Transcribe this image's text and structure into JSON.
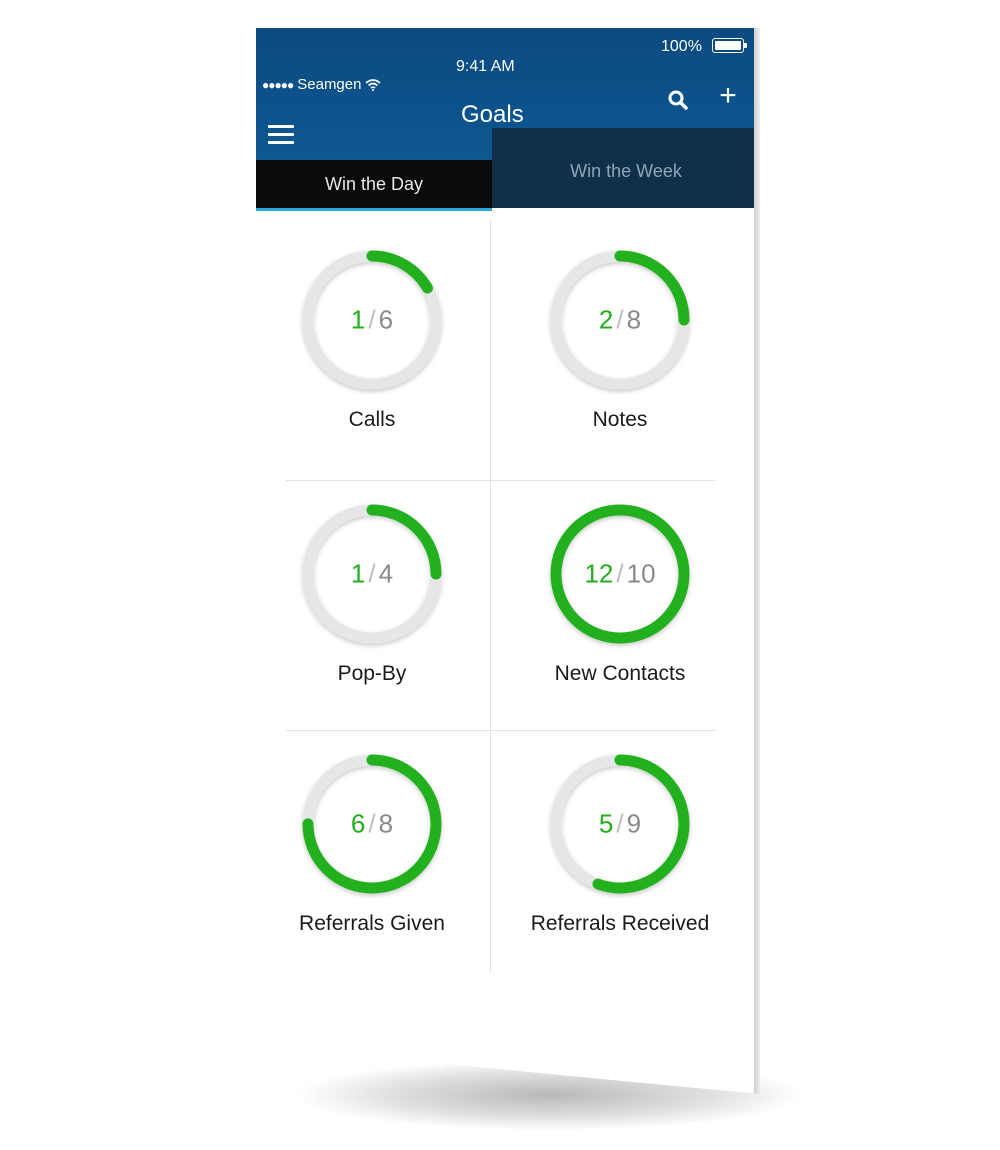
{
  "status_bar": {
    "carrier": "Seamgen",
    "time": "9:41 AM",
    "battery": "100%"
  },
  "header": {
    "title": "Goals"
  },
  "tabs": [
    {
      "label": "Win the Day",
      "active": true
    },
    {
      "label": "Win the Week",
      "active": false
    }
  ],
  "goals": [
    {
      "label": "Calls",
      "done": "1",
      "target": "6",
      "progress": 0.1667
    },
    {
      "label": "Notes",
      "done": "2",
      "target": "8",
      "progress": 0.25
    },
    {
      "label": "Pop-By",
      "done": "1",
      "target": "4",
      "progress": 0.25
    },
    {
      "label": "New Contacts",
      "done": "12",
      "target": "10",
      "progress": 1.0
    },
    {
      "label": "Referrals Given",
      "done": "6",
      "target": "8",
      "progress": 0.75
    },
    {
      "label": "Referrals Received",
      "done": "5",
      "target": "9",
      "progress": 0.5556
    }
  ],
  "colors": {
    "header_blue": "#0f5d99",
    "active_tab": "#0b0b0b",
    "inactive_tab": "#10304a",
    "tab_indicator": "#29a8e0",
    "progress_green": "#22b01e",
    "ring_track": "#e6e6e6"
  },
  "icons": {
    "menu": "hamburger-icon",
    "search": "search-icon",
    "add": "plus-icon",
    "wifi": "wifi-icon",
    "battery": "battery-icon"
  }
}
